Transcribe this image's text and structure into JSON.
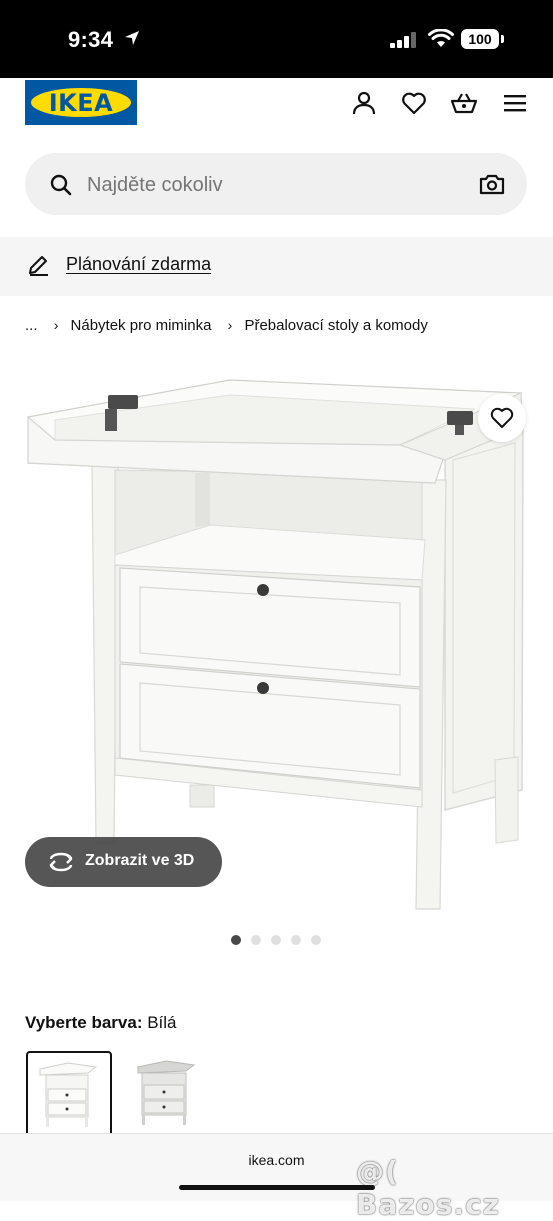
{
  "status_bar": {
    "time": "9:34",
    "battery": "100"
  },
  "header": {
    "logo_text": "IKEA",
    "icons": [
      "user-icon",
      "heart-icon",
      "basket-icon",
      "menu-icon"
    ]
  },
  "search": {
    "placeholder": "Najděte cokoliv"
  },
  "planning": {
    "label": "Plánování zdarma"
  },
  "breadcrumb": {
    "ellipsis": "...",
    "items": [
      "Nábytek pro miminka",
      "Přebalovací stoly a komody"
    ]
  },
  "product": {
    "view_3d_label": "Zobrazit ve 3D",
    "image_dots": {
      "count": 5,
      "active": 0
    }
  },
  "color": {
    "prompt": "Vyberte barva:",
    "selected": "Bílá",
    "swatches": [
      "white",
      "grey"
    ]
  },
  "browser": {
    "url": "ikea.com"
  },
  "watermark": "@( Bazos.cz",
  "colors": {
    "ikea_blue": "#0058a3",
    "ikea_yellow": "#ffdb00",
    "status_bar": "#000000"
  }
}
